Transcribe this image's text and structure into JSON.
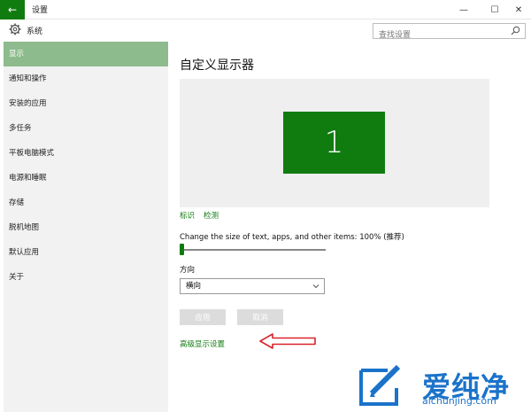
{
  "window": {
    "title": "设置",
    "back_icon": "←",
    "minimize": "—",
    "maximize": "☐",
    "close": "✕"
  },
  "header": {
    "title": "系统",
    "search_placeholder": "查找设置",
    "icon": "gear-icon"
  },
  "sidebar": {
    "items": [
      {
        "label": "显示",
        "active": true
      },
      {
        "label": "通知和操作"
      },
      {
        "label": "安装的应用"
      },
      {
        "label": "多任务"
      },
      {
        "label": "平板电脑模式"
      },
      {
        "label": "电源和睡眠"
      },
      {
        "label": "存储"
      },
      {
        "label": "脱机地图"
      },
      {
        "label": "默认应用"
      },
      {
        "label": "关于"
      }
    ]
  },
  "main": {
    "title": "自定义显示器",
    "monitor_number": "1",
    "identify_link": "标识",
    "detect_link": "检测",
    "scale_label": "Change the size of text, apps, and other items: 100% (推荐)",
    "scale_value": 0,
    "orientation_label": "方向",
    "orientation_value": "横向",
    "apply_button": "应用",
    "cancel_button": "取消",
    "advanced_link": "高级显示设置"
  },
  "watermark": {
    "text": "爱纯净",
    "url": "aichunjing.com"
  },
  "colors": {
    "accent": "#107c10",
    "sidebar_active": "#8dbb8d",
    "arrow": "#d9232a",
    "watermark": "#1a73c9"
  }
}
